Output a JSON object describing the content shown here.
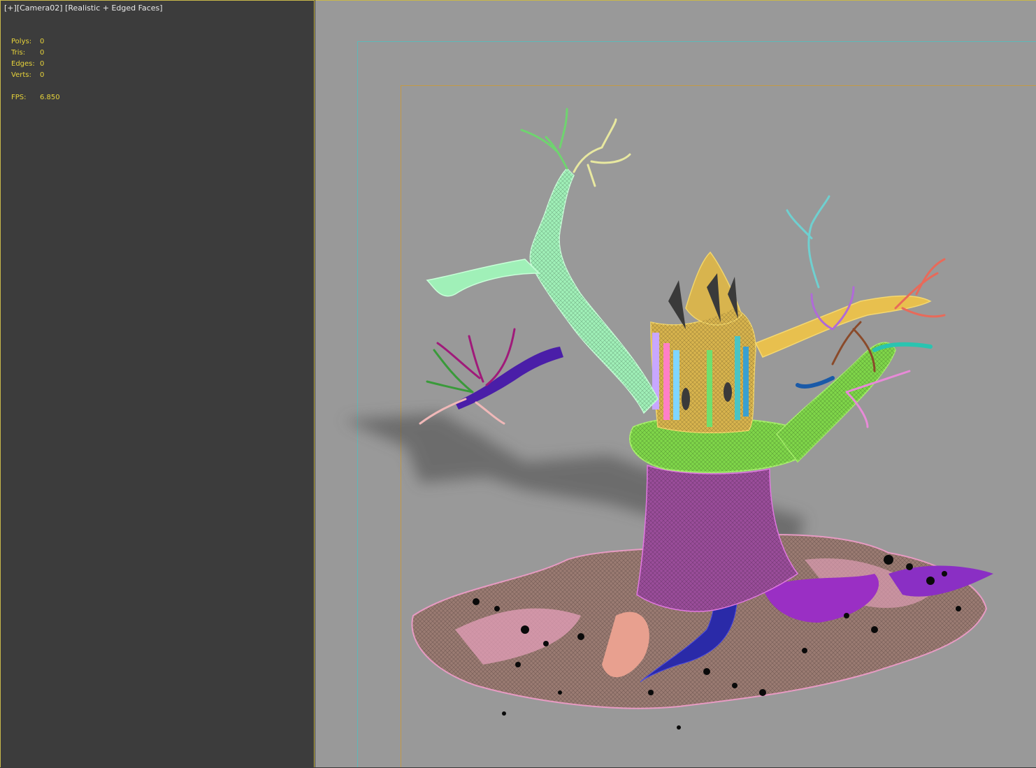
{
  "viewport_label": {
    "plus": "[+]",
    "camera": "[Camera02]",
    "shading": "[Realistic + Edged Faces]"
  },
  "stats": {
    "polys_label": "Polys:",
    "polys_value": "0",
    "tris_label": "Tris:",
    "tris_value": "0",
    "edges_label": "Edges:",
    "edges_value": "0",
    "verts_label": "Verts:",
    "verts_value": "0",
    "fps_label": "FPS:",
    "fps_value": "6.850"
  },
  "colors": {
    "viewport_bg": "#999999",
    "stats_text": "#e6d23a",
    "active_border": "#c9b84a",
    "safe_frame_outer": "#5fb8b8",
    "safe_frame_inner": "#c49a45"
  }
}
